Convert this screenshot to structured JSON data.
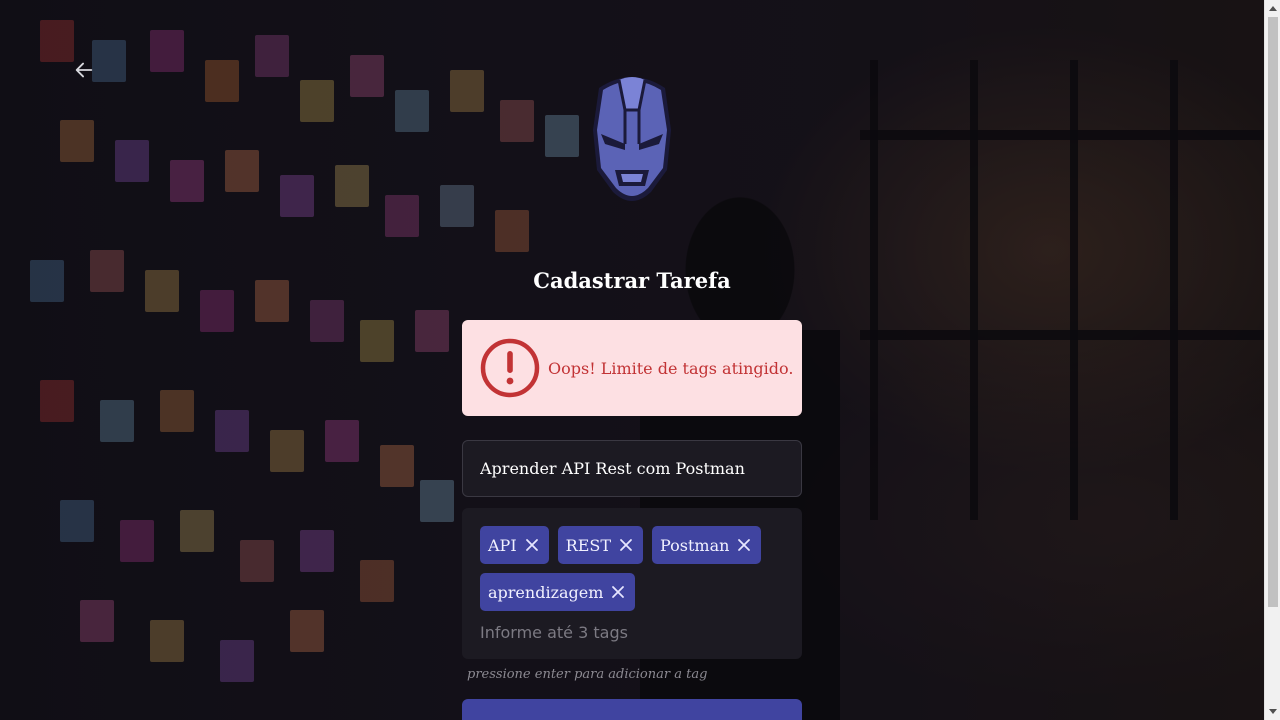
{
  "page": {
    "title": "Cadastrar Tarefa"
  },
  "alert": {
    "message": "Oops! Limite de tags atingido.",
    "icon": "exclamation-circle-icon",
    "color": "#c23335",
    "background": "#fde0e3"
  },
  "form": {
    "task_value": "Aprender API Rest com Postman",
    "tags": [
      {
        "label": "API"
      },
      {
        "label": "REST"
      },
      {
        "label": "Postman"
      },
      {
        "label": "aprendizagem"
      }
    ],
    "tag_placeholder": "Informe até 3 tags",
    "hint": "pressione enter para adicionar a tag"
  },
  "colors": {
    "accent": "#4044a0",
    "logo": "#5b63b6"
  },
  "icons": {
    "back": "arrow-left-icon",
    "logo": "iron-man-helmet-icon",
    "tag_remove": "close-icon"
  }
}
